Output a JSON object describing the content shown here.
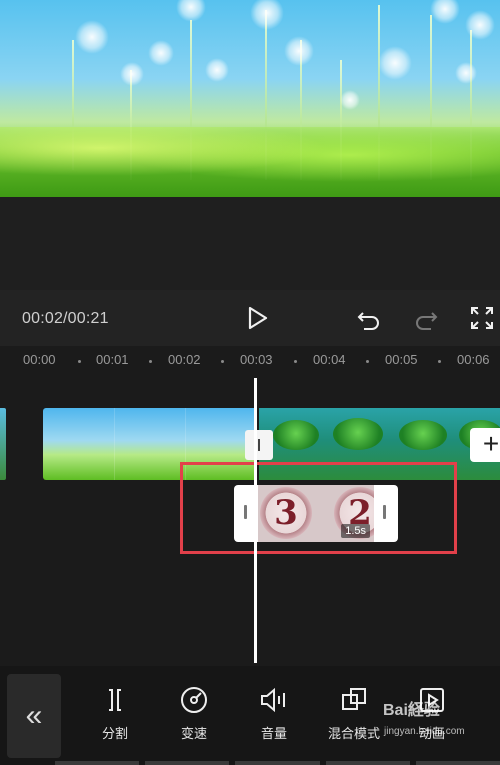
{
  "player": {
    "time_display": "00:02/00:21"
  },
  "ruler": {
    "ticks": [
      "00:00",
      "00:01",
      "00:02",
      "00:03",
      "00:04",
      "00:05",
      "00:06"
    ]
  },
  "timeline": {
    "overlay_clip": {
      "numbers": [
        "3",
        "2"
      ],
      "duration": "1.5s"
    },
    "add_label": "+"
  },
  "toolbar": {
    "collapse_label": "«",
    "tools": [
      {
        "label": "分割",
        "icon": "split-icon"
      },
      {
        "label": "变速",
        "icon": "speed-icon"
      },
      {
        "label": "音量",
        "icon": "volume-icon"
      },
      {
        "label": "混合模式",
        "icon": "blend-mode-icon"
      },
      {
        "label": "动画",
        "icon": "animation-icon"
      }
    ]
  },
  "watermark": {
    "text": "Bai経验",
    "url": "jingyan.baidu.com"
  },
  "colors": {
    "highlight": "#e2404a",
    "background": "#1b1b1b"
  }
}
